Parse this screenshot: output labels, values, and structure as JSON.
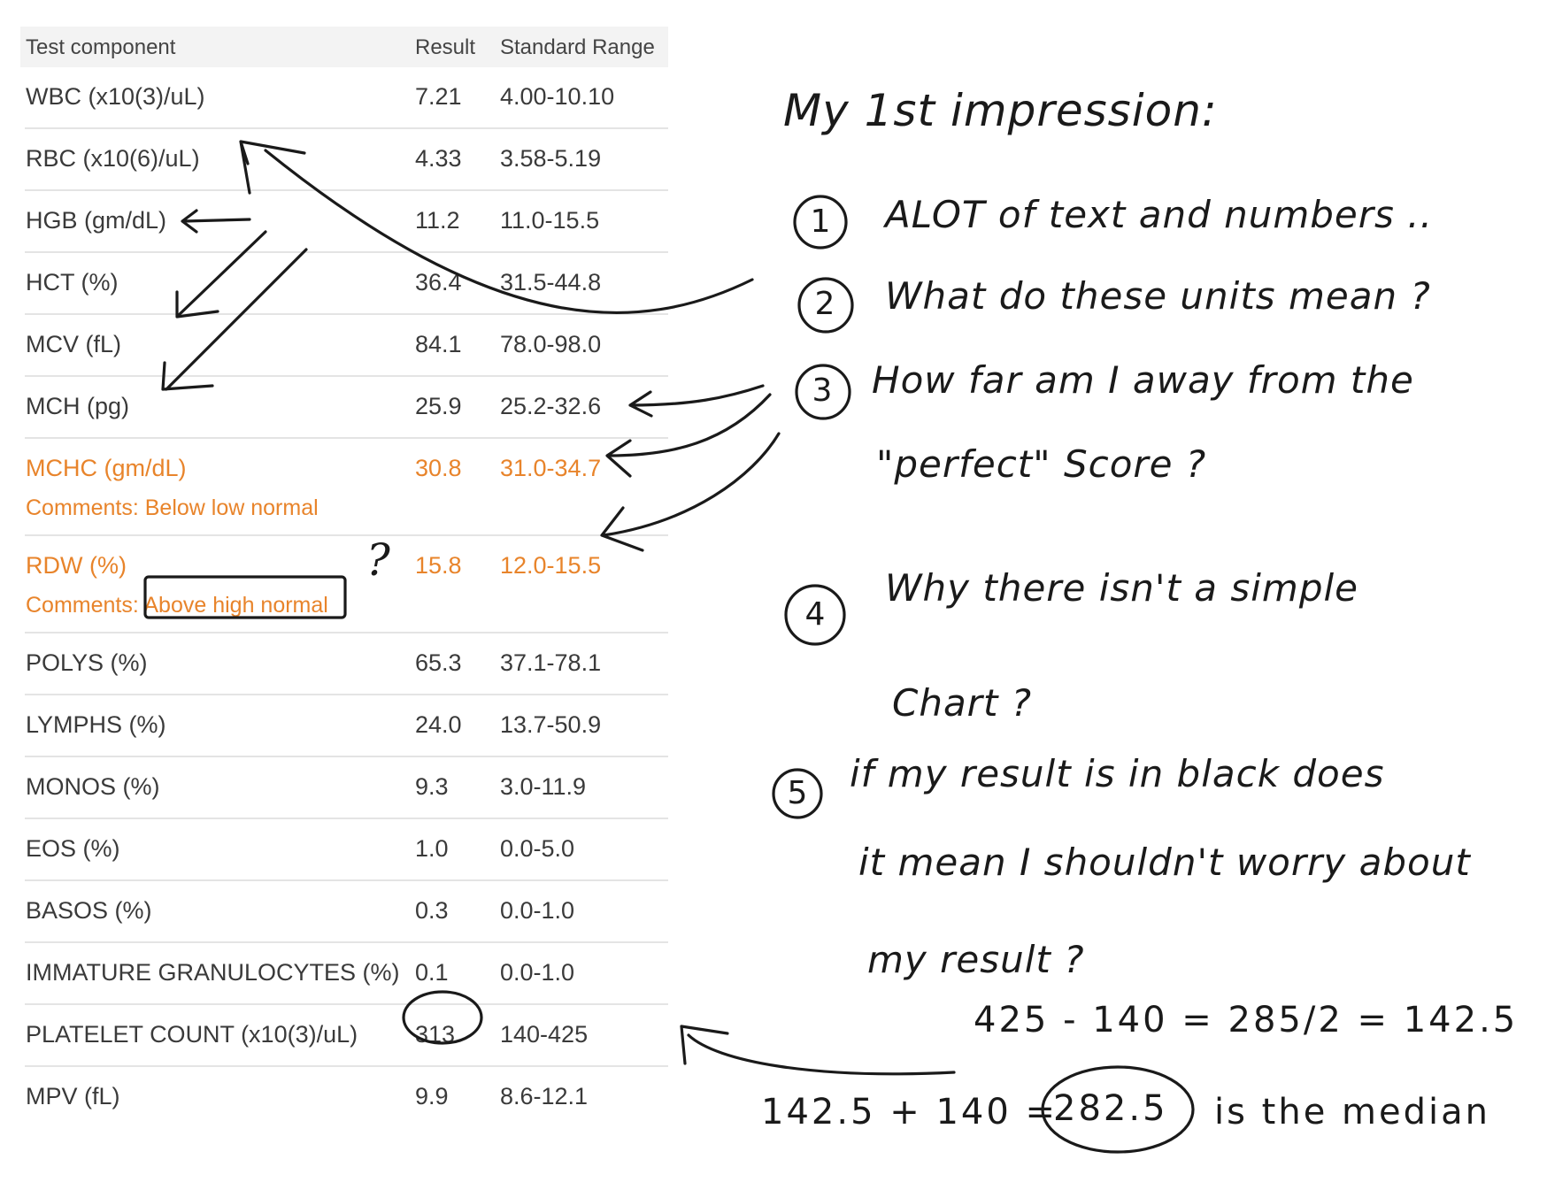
{
  "table": {
    "headers": [
      "Test component",
      "Result",
      "Standard Range"
    ],
    "rows": [
      {
        "name": "WBC (x10(3)/uL)",
        "result": "7.21",
        "range": "4.00-10.10"
      },
      {
        "name": "RBC (x10(6)/uL)",
        "result": "4.33",
        "range": "3.58-5.19"
      },
      {
        "name": "HGB (gm/dL)",
        "result": "11.2",
        "range": "11.0-15.5"
      },
      {
        "name": "HCT (%)",
        "result": "36.4",
        "range": "31.5-44.8"
      },
      {
        "name": "MCV (fL)",
        "result": "84.1",
        "range": "78.0-98.0"
      },
      {
        "name": "MCH (pg)",
        "result": "25.9",
        "range": "25.2-32.6"
      },
      {
        "name": "MCHC (gm/dL)",
        "result": "30.8",
        "range": "31.0-34.7",
        "comment": "Comments: Below low normal",
        "flag_color": "#e8842b"
      },
      {
        "name": "RDW (%)",
        "result": "15.8",
        "range": "12.0-15.5",
        "comment": "Comments: Above high normal",
        "flag_color": "#e8842b"
      },
      {
        "name": "POLYS (%)",
        "result": "65.3",
        "range": "37.1-78.1"
      },
      {
        "name": "LYMPHS (%)",
        "result": "24.0",
        "range": "13.7-50.9"
      },
      {
        "name": "MONOS (%)",
        "result": "9.3",
        "range": "3.0-11.9"
      },
      {
        "name": "EOS (%)",
        "result": "1.0",
        "range": "0.0-5.0"
      },
      {
        "name": "BASOS (%)",
        "result": "0.3",
        "range": "0.0-1.0"
      },
      {
        "name": "IMMATURE GRANULOCYTES (%)",
        "result": "0.1",
        "range": "0.0-1.0"
      },
      {
        "name": "PLATELET COUNT (x10(3)/uL)",
        "result": "313",
        "range": "140-425"
      },
      {
        "name": "MPV (fL)",
        "result": "9.9",
        "range": "8.6-12.1"
      }
    ]
  },
  "notes": {
    "title": "My 1st impression:",
    "items": [
      {
        "num": "1",
        "text": "ALOT of text and numbers .."
      },
      {
        "num": "2",
        "text": "What do these units mean ?"
      },
      {
        "num": "3",
        "text": "How far am I away from the",
        "text2": "\"perfect\" Score ?"
      },
      {
        "num": "4",
        "text": "Why there isn't a simple",
        "text2": "Chart ?"
      },
      {
        "num": "5",
        "text": "if my result is in black does",
        "text2": "it mean I shouldn't worry about",
        "text3": "my result ?"
      }
    ],
    "question_mark": "?",
    "calc_line1": "425 - 140 = 285/2 = 142.5",
    "calc_line2_a": "142.5 + 140 =",
    "calc_line2_circled": "282.5",
    "calc_line2_b": "is the median"
  },
  "colors": {
    "flag": "#e8842b",
    "header_bg": "#f3f3f3",
    "ink": "#1a1a1a"
  }
}
